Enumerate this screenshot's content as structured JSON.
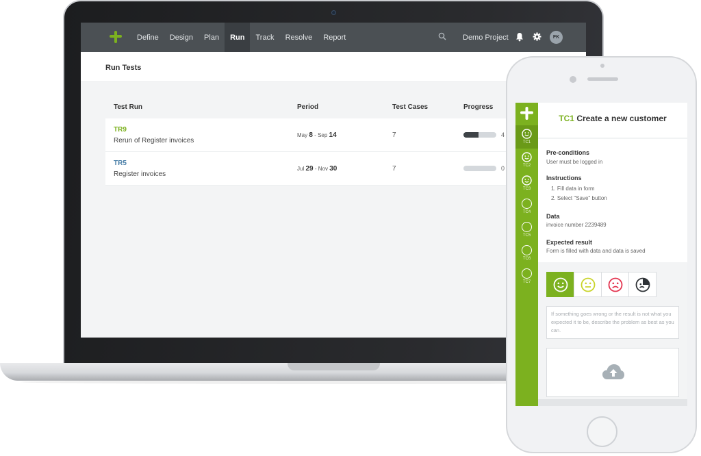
{
  "nav": {
    "items": [
      {
        "label": "Define",
        "active": false
      },
      {
        "label": "Design",
        "active": false
      },
      {
        "label": "Plan",
        "active": false
      },
      {
        "label": "Run",
        "active": true
      },
      {
        "label": "Track",
        "active": false
      },
      {
        "label": "Resolve",
        "active": false
      },
      {
        "label": "Report",
        "active": false
      }
    ],
    "project": "Demo Project",
    "avatar_initials": "FK"
  },
  "page": {
    "title": "Run Tests"
  },
  "table": {
    "headers": [
      "Test Run",
      "Period",
      "Test Cases",
      "Progress"
    ],
    "rows": [
      {
        "id": "TR9",
        "id_color": "#7cb11f",
        "name": "Rerun of Register invoices",
        "start_month": "May",
        "start_day": "8",
        "end_month": "Sep",
        "end_day": "14",
        "cases": "7",
        "progress": 0.45,
        "progress_label": "4"
      },
      {
        "id": "TR5",
        "id_color": "#4a7fa8",
        "name": "Register invoices",
        "start_month": "Jul",
        "start_day": "29",
        "end_month": "Nov",
        "end_day": "30",
        "cases": "7",
        "progress": 0.0,
        "progress_label": "0"
      }
    ]
  },
  "mobile": {
    "test_cases": [
      {
        "label": "TC1",
        "state": "happy"
      },
      {
        "label": "TC2",
        "state": "happy"
      },
      {
        "label": "TC3",
        "state": "happy"
      },
      {
        "label": "TC4",
        "state": "empty"
      },
      {
        "label": "TC5",
        "state": "empty"
      },
      {
        "label": "TC6",
        "state": "empty"
      },
      {
        "label": "TC7",
        "state": "empty"
      }
    ],
    "case_code": "TC1",
    "case_title": "Create a new customer",
    "preconditions_heading": "Pre-conditions",
    "preconditions_text": "User must be logged in",
    "instructions_heading": "Instructions",
    "instruction_1": "1. Fill data in form",
    "instruction_2": "2. Select \"Save\" button",
    "data_heading": "Data",
    "data_text": "invoice number 2239489",
    "expected_heading": "Expected result",
    "expected_text": "Form is filled with data and data is saved",
    "comment_placeholder": "If something goes wrong or the result is not what you expected it to be, describe the problem as best as you can.",
    "result_options": [
      "passed-icon",
      "warning-icon",
      "failed-icon",
      "blocked-icon"
    ],
    "selected_result": "passed",
    "accent": "#7cb11f"
  }
}
